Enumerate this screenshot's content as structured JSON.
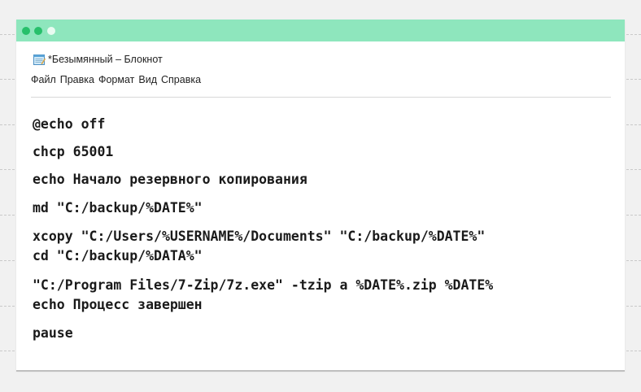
{
  "window": {
    "title": "*Безымянный – Блокнот",
    "app_icon": "notepad-icon",
    "titlebar_color": "#8ee6bd"
  },
  "menu": {
    "items": [
      "Файл",
      "Правка",
      "Формат",
      "Вид",
      "Справка"
    ]
  },
  "editor": {
    "lines": [
      "@echo off",
      "chcp 65001",
      "echo Начало резервного копирования",
      "md \"C:/backup/%DATE%\"",
      "xcopy \"C:/Users/%USERNAME%/Documents\" \"C:/backup/%DATE%\"",
      "cd \"C:/backup/%DATA%\"",
      "\"C:/Program Files/7-Zip/7z.exe\" -tzip a %DATE%.zip %DATE%",
      "echo Процесс завершен",
      "pause"
    ]
  }
}
